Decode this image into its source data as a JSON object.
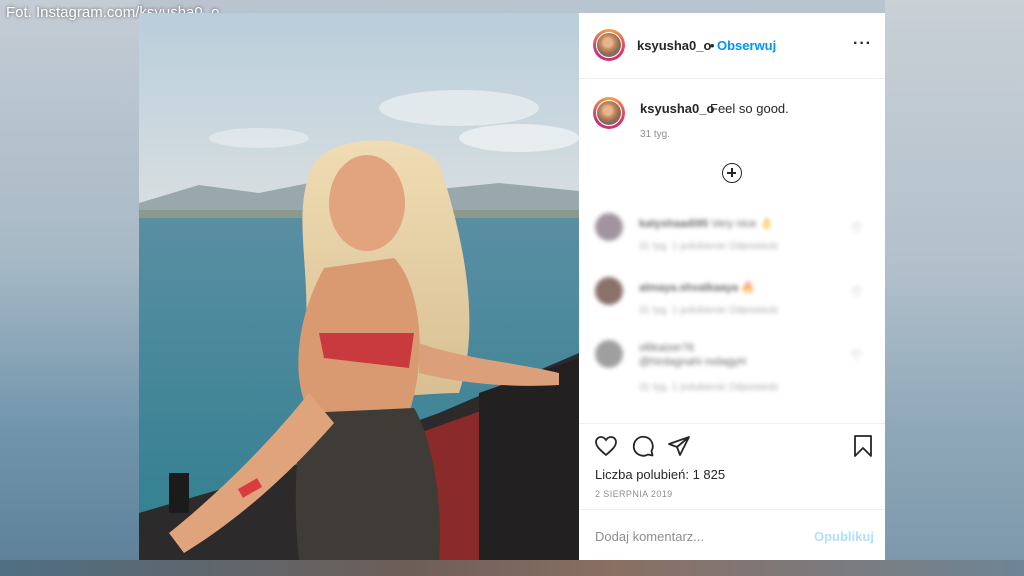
{
  "credit": "Fot. Instagram.com/ksyusha0_o",
  "header": {
    "username": "ksyusha0_o",
    "separator": "•",
    "follow_label": "Obserwuj",
    "more_label": "···"
  },
  "caption": {
    "username": "ksyusha0_o",
    "text": "Feel so good.",
    "time": "31 tyg."
  },
  "comments": [
    {
      "user": "katyshaadi95",
      "text": "Very nice 👌",
      "meta": "31 tyg.   1 polubienie   Odpowiedz"
    },
    {
      "user": "almaya.shvalkaaya",
      "text": "🔥",
      "meta": "31 tyg.   1 polubienie   Odpowiedz"
    },
    {
      "user": "ollikaizer76",
      "text": "@hirdagnahi rodagyH",
      "meta": "31 tyg.   1 polubienie   Odpowiedz"
    }
  ],
  "likes_text": "Liczba polubień: 1 825",
  "date": "2 SIERPNIA 2019",
  "add_comment": {
    "placeholder": "Dodaj komentarz...",
    "publish_label": "Opublikuj"
  },
  "icons": {
    "like": "heart-icon",
    "comment": "comment-icon",
    "share": "share-icon",
    "save": "bookmark-icon",
    "add": "plus-circle-icon"
  },
  "colors": {
    "follow": "#0095f6",
    "publish_disabled": "#b2dffc",
    "text": "#262626",
    "muted": "#8e8e8e"
  }
}
